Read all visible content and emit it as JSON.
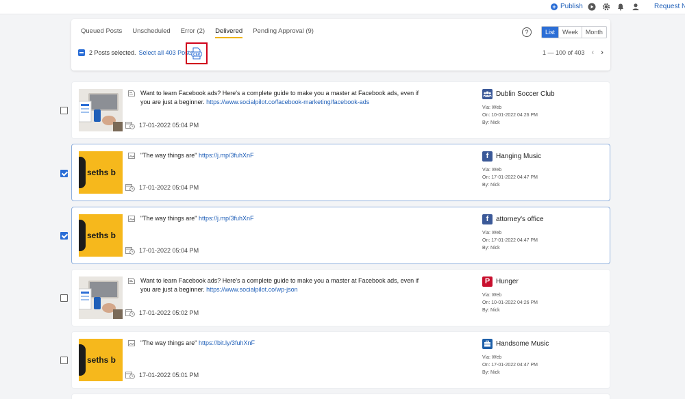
{
  "topbar": {
    "publish_label": "Publish",
    "request_label": "Request Ne"
  },
  "tabs": [
    {
      "label": "Queued Posts",
      "active": false
    },
    {
      "label": "Unscheduled",
      "active": false
    },
    {
      "label": "Error (2)",
      "active": false
    },
    {
      "label": "Delivered",
      "active": true
    },
    {
      "label": "Pending Approval (9)",
      "active": false
    }
  ],
  "help_label": "?",
  "view_switch": [
    "List",
    "Week",
    "Month"
  ],
  "view_active": "List",
  "selection": {
    "selected_text": "2 Posts selected.",
    "select_all_text": "Select all 403 Posts"
  },
  "pagination": {
    "range": "1 — 100 of 403"
  },
  "posts": [
    {
      "selected": false,
      "thumb": "laptop",
      "text": "Want to learn Facebook ads? Here's a complete guide to make you a master at Facebook ads, even if you are just a beginner.",
      "link": "https://www.socialpilot.co/facebook-marketing/facebook-ads",
      "time": "17-01-2022 05:04 PM",
      "account": "Dublin Soccer Club",
      "network_icon": "group-icon",
      "via": "Via: Web",
      "on": "On: 10-01-2022 04:26 PM",
      "by": "By: Nick"
    },
    {
      "selected": true,
      "thumb": "yellow",
      "text": "\"The way things are\"",
      "link": "https://j.mp/3fuhXnF",
      "time": "17-01-2022 05:04 PM",
      "account": "Hanging Music",
      "network_icon": "facebook-icon",
      "via": "Via: Web",
      "on": "On: 17-01-2022 04:47 PM",
      "by": "By: Nick"
    },
    {
      "selected": true,
      "thumb": "yellow",
      "text": "\"The way things are\"",
      "link": "https://j.mp/3fuhXnF",
      "time": "17-01-2022 05:04 PM",
      "account": "attorney's office",
      "network_icon": "facebook-icon",
      "via": "Via: Web",
      "on": "On: 17-01-2022 04:47 PM",
      "by": "By: Nick"
    },
    {
      "selected": false,
      "thumb": "laptop",
      "text": "Want to learn Facebook ads? Here's a complete guide to make you a master at Facebook ads, even if you are just a beginner.",
      "link": "https://www.socialpilot.co/wp-json",
      "time": "17-01-2022 05:02 PM",
      "account": "Hunger",
      "network_icon": "pinterest-icon",
      "via": "Via: Web",
      "on": "On: 10-01-2022 04:26 PM",
      "by": "By: Nick"
    },
    {
      "selected": false,
      "thumb": "yellow",
      "text": "\"The way things are\"",
      "link": "https://bit.ly/3fuhXnF",
      "time": "17-01-2022 05:01 PM",
      "account": "Handsome Music",
      "network_icon": "linkedin-company-icon",
      "via": "Via: Web",
      "on": "On: 17-01-2022 04:47 PM",
      "by": "By: Nick"
    }
  ],
  "thumb_text": "seths b",
  "colors": {
    "accent": "#2b6ed6",
    "link": "#1f5fb8",
    "tab_underline": "#f0b400",
    "csv_highlight": "#d0021b",
    "facebook": "#3b5998",
    "pinterest": "#c8102e",
    "group": "#3b5998",
    "linkedin": "#1e5fa8"
  }
}
